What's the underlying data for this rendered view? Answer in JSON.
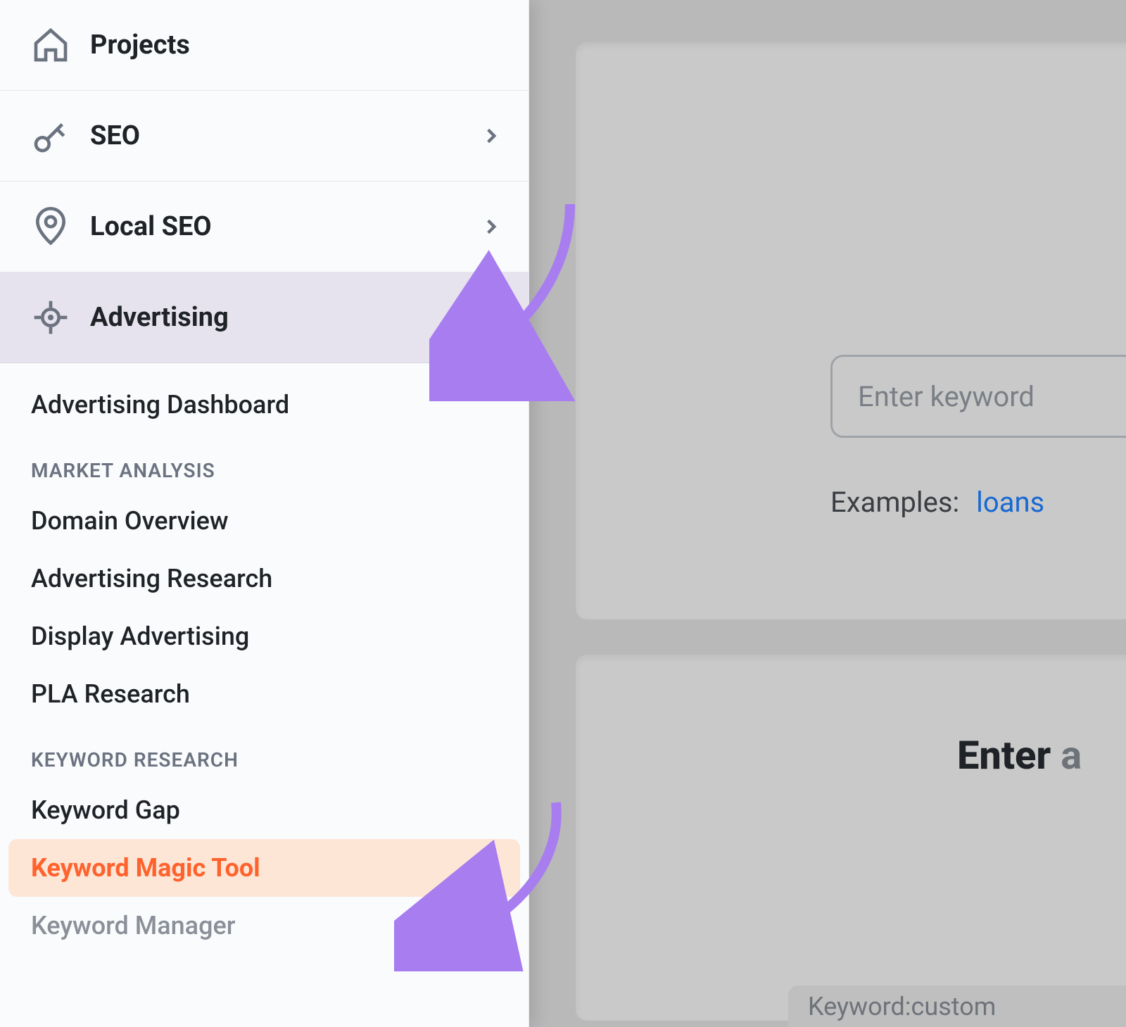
{
  "sidebar": {
    "projects": {
      "label": "Projects"
    },
    "seo": {
      "label": "SEO"
    },
    "local_seo": {
      "label": "Local SEO"
    },
    "advertising": {
      "label": "Advertising"
    },
    "advertising_dashboard": "Advertising Dashboard",
    "sections": {
      "market_analysis": {
        "header": "MARKET ANALYSIS",
        "items": [
          "Domain Overview",
          "Advertising Research",
          "Display Advertising",
          "PLA Research"
        ]
      },
      "keyword_research": {
        "header": "KEYWORD RESEARCH",
        "items": [
          "Keyword Gap",
          "Keyword Magic Tool",
          "Keyword Manager"
        ]
      }
    }
  },
  "main": {
    "keyword_input_placeholder": "Enter keyword",
    "examples_label": "Examples:",
    "examples": [
      "loans"
    ],
    "enter_heading_prefix": "Enter ",
    "enter_heading_faded": "a",
    "keyword_chip_prefix": "Keyword: ",
    "keyword_chip_value": "custom"
  },
  "colors": {
    "accent_orange": "#ff622d",
    "highlight_bg": "#fde6d6",
    "annotation_purple": "#a87df0"
  }
}
